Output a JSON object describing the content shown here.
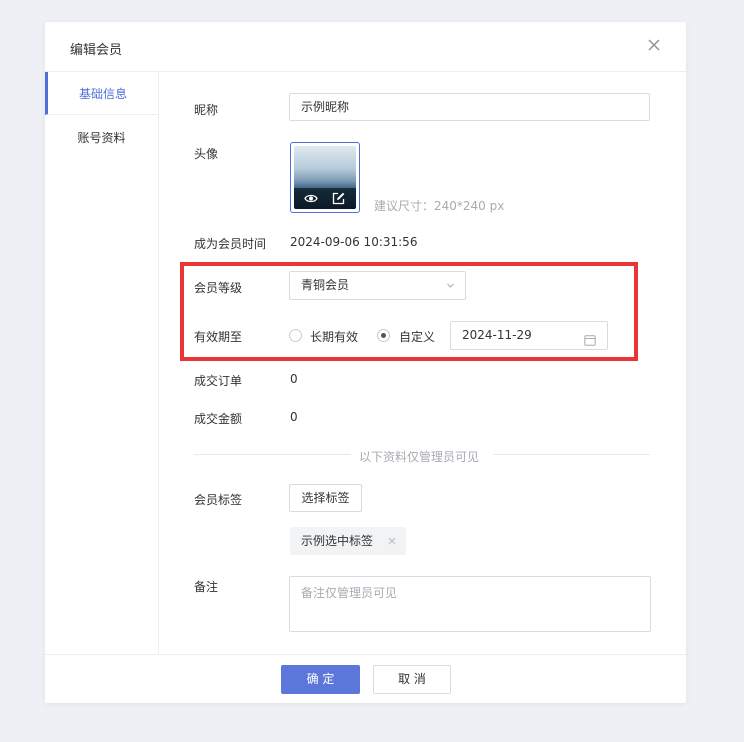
{
  "dialog": {
    "title": "编辑会员",
    "close_icon": "close-icon"
  },
  "side_nav": {
    "items": [
      {
        "label": "基础信息",
        "active": true
      },
      {
        "label": "账号资料",
        "active": false
      }
    ]
  },
  "form": {
    "nickname": {
      "label": "昵称",
      "value": "示例昵称"
    },
    "avatar": {
      "label": "头像",
      "hint": "建议尺寸：240*240 px",
      "icons": [
        "eye-icon",
        "edit-icon"
      ]
    },
    "member_since": {
      "label": "成为会员时间",
      "value": "2024-09-06 10:31:56"
    },
    "level": {
      "label": "会员等级",
      "value": "青铜会员"
    },
    "valid_until": {
      "label": "有效期至",
      "options": [
        "长期有效",
        "自定义"
      ],
      "selected": "自定义",
      "date": "2024-11-29"
    },
    "orders": {
      "label": "成交订单",
      "value": "0"
    },
    "amount": {
      "label": "成交金额",
      "value": "0"
    },
    "divider": "以下资料仅管理员可见",
    "tags": {
      "label": "会员标签",
      "button": "选择标签",
      "selected_tag": "示例选中标签"
    },
    "remark": {
      "label": "备注",
      "placeholder": "备注仅管理员可见"
    }
  },
  "footer": {
    "confirm": "确 定",
    "cancel": "取 消"
  },
  "colors": {
    "accent": "#4e6fd6",
    "highlight": "#e83535"
  }
}
